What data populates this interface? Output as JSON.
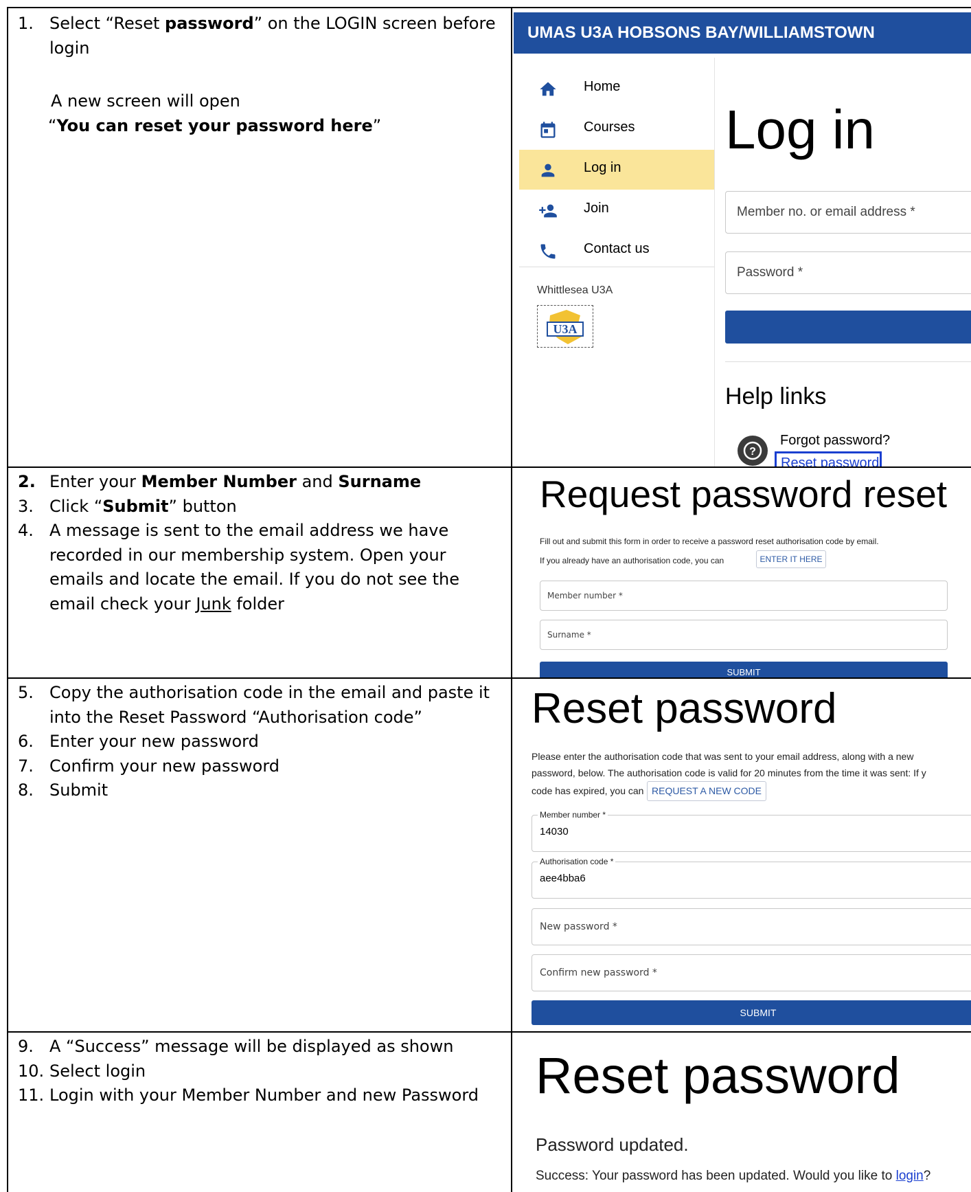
{
  "row1": {
    "step1_num": "1.",
    "step1_a": "Select “Reset ",
    "step1_b": "password",
    "step1_c": "” on the LOGIN screen before login",
    "note_line1": "A new screen will open",
    "note_q_open": "“",
    "note_bold": "You can reset your password here",
    "note_q_close": "”",
    "banner": "UMAS U3A HOBSONS BAY/WILLIAMSTOWN",
    "nav": [
      {
        "label": "Home",
        "icon": "home-icon"
      },
      {
        "label": "Courses",
        "icon": "calendar-icon"
      },
      {
        "label": "Log in",
        "icon": "person-icon"
      },
      {
        "label": "Join",
        "icon": "person-add-icon"
      },
      {
        "label": "Contact us",
        "icon": "phone-icon"
      }
    ],
    "org_name": "Whittlesea U3A",
    "login_title": "Log in",
    "member_field": "Member no. or email address *",
    "password_field": "Password *",
    "help_title": "Help links",
    "forgot": "Forgot password?",
    "reset_link": "Reset password"
  },
  "row2": {
    "steps": [
      {
        "num": "2.",
        "a": "Enter your ",
        "b": "Member Number",
        "c": " and ",
        "d": "Surname"
      },
      {
        "num": "3.",
        "a": "Click “",
        "b": "Submit",
        "c": "” button"
      },
      {
        "num": "4.",
        "a": "A message is sent to the email address we have recorded in our membership system. Open your emails and locate the email.  If you do not see the email check your ",
        "u": "Junk",
        "c": " folder"
      }
    ],
    "title": "Request password reset",
    "intro": "Fill out and submit this form in order to receive a password reset authorisation code by email.",
    "code_line": "If you already have an authorisation code, you can",
    "enter_here": "ENTER IT HERE",
    "member_field": "Member number *",
    "surname_field": "Surname *",
    "submit": "SUBMIT"
  },
  "row3": {
    "steps": [
      {
        "num": "5.",
        "text": "Copy the authorisation code in the email and paste it into the Reset Password “Authorisation code”"
      },
      {
        "num": "6.",
        "text": "Enter your new password"
      },
      {
        "num": "7.",
        "text": "Confirm your new password"
      },
      {
        "num": "8.",
        "text": "Submit"
      }
    ],
    "title": "Reset password",
    "line1": "Please enter the authorisation code that was sent to your email address, along with a new",
    "line2": "password, below. The authorisation code is valid for 20 minutes from the time it was sent: If y",
    "line3": "code has expired, you can",
    "request_code": "REQUEST A NEW CODE",
    "member_label": "Member number *",
    "member_value": "14030",
    "auth_label": "Authorisation code *",
    "auth_value": "aee4bba6",
    "new_password": "New password *",
    "confirm_password": "Confirm new password *",
    "submit": "SUBMIT"
  },
  "row4": {
    "steps": [
      {
        "num": "9.",
        "text": "A “Success” message will be displayed as shown"
      },
      {
        "num": "10.",
        "text": "Select login"
      },
      {
        "num": "11.",
        "text": "Login with your Member Number and new Password"
      }
    ],
    "title": "Reset password",
    "updated": "Password updated.",
    "success_text": "Success: Your password has been updated. Would you like to",
    "login_link": "login",
    "qmark": "?"
  }
}
